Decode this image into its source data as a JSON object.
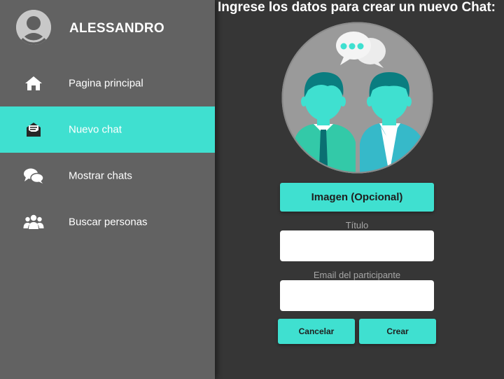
{
  "user": {
    "name": "ALESSANDRO"
  },
  "sidebar": {
    "items": [
      {
        "label": "Pagina principal",
        "icon": "home-icon",
        "active": false
      },
      {
        "label": "Nuevo chat",
        "icon": "envelope-open-icon",
        "active": true
      },
      {
        "label": "Mostrar chats",
        "icon": "chat-bubbles-icon",
        "active": false
      },
      {
        "label": "Buscar personas",
        "icon": "people-icon",
        "active": false
      }
    ]
  },
  "main": {
    "title": "Ingrese los datos para crear un nuevo Chat:",
    "image_button": "Imagen (Opcional)",
    "title_field": {
      "label": "Título",
      "value": "",
      "placeholder": ""
    },
    "email_field": {
      "label": "Email del participante",
      "value": "",
      "placeholder": ""
    },
    "cancel_button": "Cancelar",
    "create_button": "Crear"
  },
  "colors": {
    "accent": "#3fe0d0",
    "sidebar_bg": "#626262",
    "main_bg": "#363636"
  }
}
